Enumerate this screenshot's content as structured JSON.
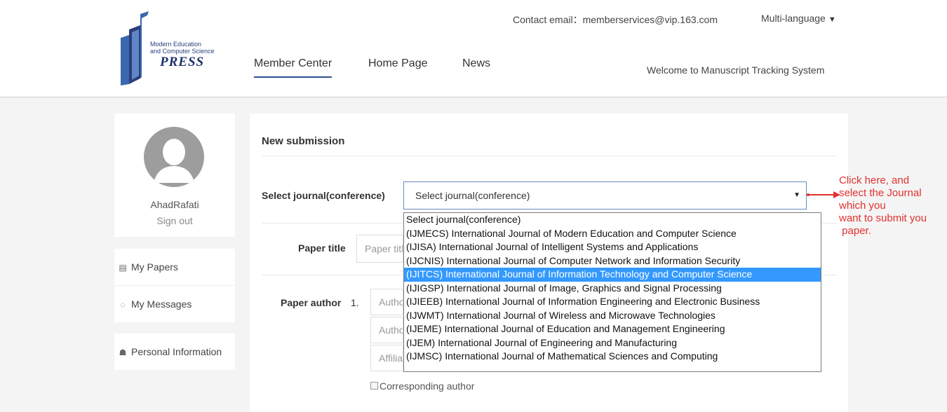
{
  "header": {
    "logo": {
      "line1": "Modern Education",
      "line2": "and Computer Science",
      "press": "PRESS"
    },
    "contact": "Contact email：memberservices@vip.163.com",
    "language": "Multi-language",
    "nav": [
      "Member Center",
      "Home Page",
      "News"
    ],
    "welcome": "Welcome to Manuscript Tracking System"
  },
  "profile": {
    "username": "AhadRafati",
    "signout": "Sign out"
  },
  "sidebar": {
    "items": [
      {
        "label": "My Papers",
        "icon": "document-icon"
      },
      {
        "label": "My Messages",
        "icon": "chat-bubble-icon"
      },
      {
        "label": "Personal Information",
        "icon": "person-card-icon"
      }
    ]
  },
  "form": {
    "title": "New submission",
    "journal_label": "Select journal(conference)",
    "journal_value": "Select journal(conference)",
    "paper_title_label": "Paper title",
    "paper_title_placeholder": "Paper title",
    "paper_author_label": "Paper author",
    "author_number": "1.",
    "author_name_placeholder": "Author name",
    "author_email_placeholder": "Author email",
    "affiliation_placeholder": "Affiliation",
    "corresponding": "Corresponding author"
  },
  "dropdown": {
    "selected_index": 4,
    "options": [
      "Select journal(conference)",
      "(IJMECS) International Journal of Modern Education and Computer Science",
      "(IJISA) International Journal of Intelligent Systems and Applications",
      "(IJCNIS) International Journal of Computer Network and Information Security",
      "(IJITCS) International Journal of Information Technology and Computer Science",
      "(IJIGSP) International Journal of Image, Graphics and Signal Processing",
      "(IJIEEB) International Journal of Information Engineering and Electronic Business",
      "(IJWMT) International Journal of Wireless and Microwave Technologies",
      "(IJEME) International Journal of Education and Management Engineering",
      "(IJEM) International Journal of Engineering and Manufacturing",
      "(IJMSC) International Journal of Mathematical Sciences and Computing"
    ]
  },
  "annotation": {
    "lines": [
      "Click here, and",
      "select the Journal",
      "which you",
      "want to submit you",
      " paper."
    ],
    "color": "#e23030"
  },
  "colors": {
    "nav_underline": "#2d4e8f",
    "dropdown_highlight": "#3399ff",
    "avatar": "#9d9d9d"
  }
}
